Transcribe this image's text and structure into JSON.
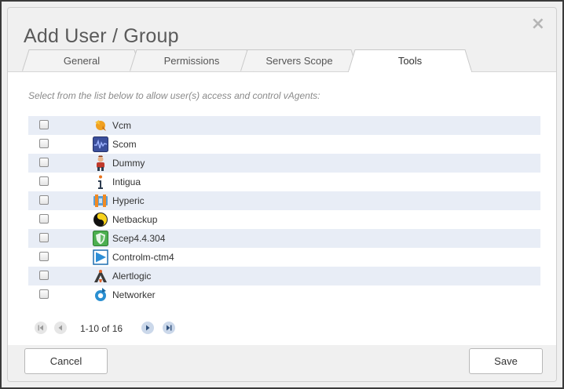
{
  "dialog": {
    "title": "Add User / Group",
    "close_glyph": "×"
  },
  "tabs": [
    {
      "label": "General",
      "active": false
    },
    {
      "label": "Permissions",
      "active": false
    },
    {
      "label": "Servers Scope",
      "active": false
    },
    {
      "label": "Tools",
      "active": true
    }
  ],
  "content": {
    "instruction": "Select from the list below to allow user(s) access and control vAgents:"
  },
  "tools": [
    {
      "label": "Vcm",
      "icon": "vcm-icon",
      "checked": false
    },
    {
      "label": "Scom",
      "icon": "scom-icon",
      "checked": false
    },
    {
      "label": "Dummy",
      "icon": "dummy-icon",
      "checked": false
    },
    {
      "label": "Intigua",
      "icon": "intigua-icon",
      "checked": false
    },
    {
      "label": "Hyperic",
      "icon": "hyperic-icon",
      "checked": false
    },
    {
      "label": "Netbackup",
      "icon": "netbackup-icon",
      "checked": false
    },
    {
      "label": "Scep4.4.304",
      "icon": "scep-icon",
      "checked": false
    },
    {
      "label": "Controlm-ctm4",
      "icon": "controlm-icon",
      "checked": false
    },
    {
      "label": "Alertlogic",
      "icon": "alertlogic-icon",
      "checked": false
    },
    {
      "label": "Networker",
      "icon": "networker-icon",
      "checked": false
    }
  ],
  "pager": {
    "info": "1-10 of 16"
  },
  "footer": {
    "cancel_label": "Cancel",
    "save_label": "Save"
  }
}
